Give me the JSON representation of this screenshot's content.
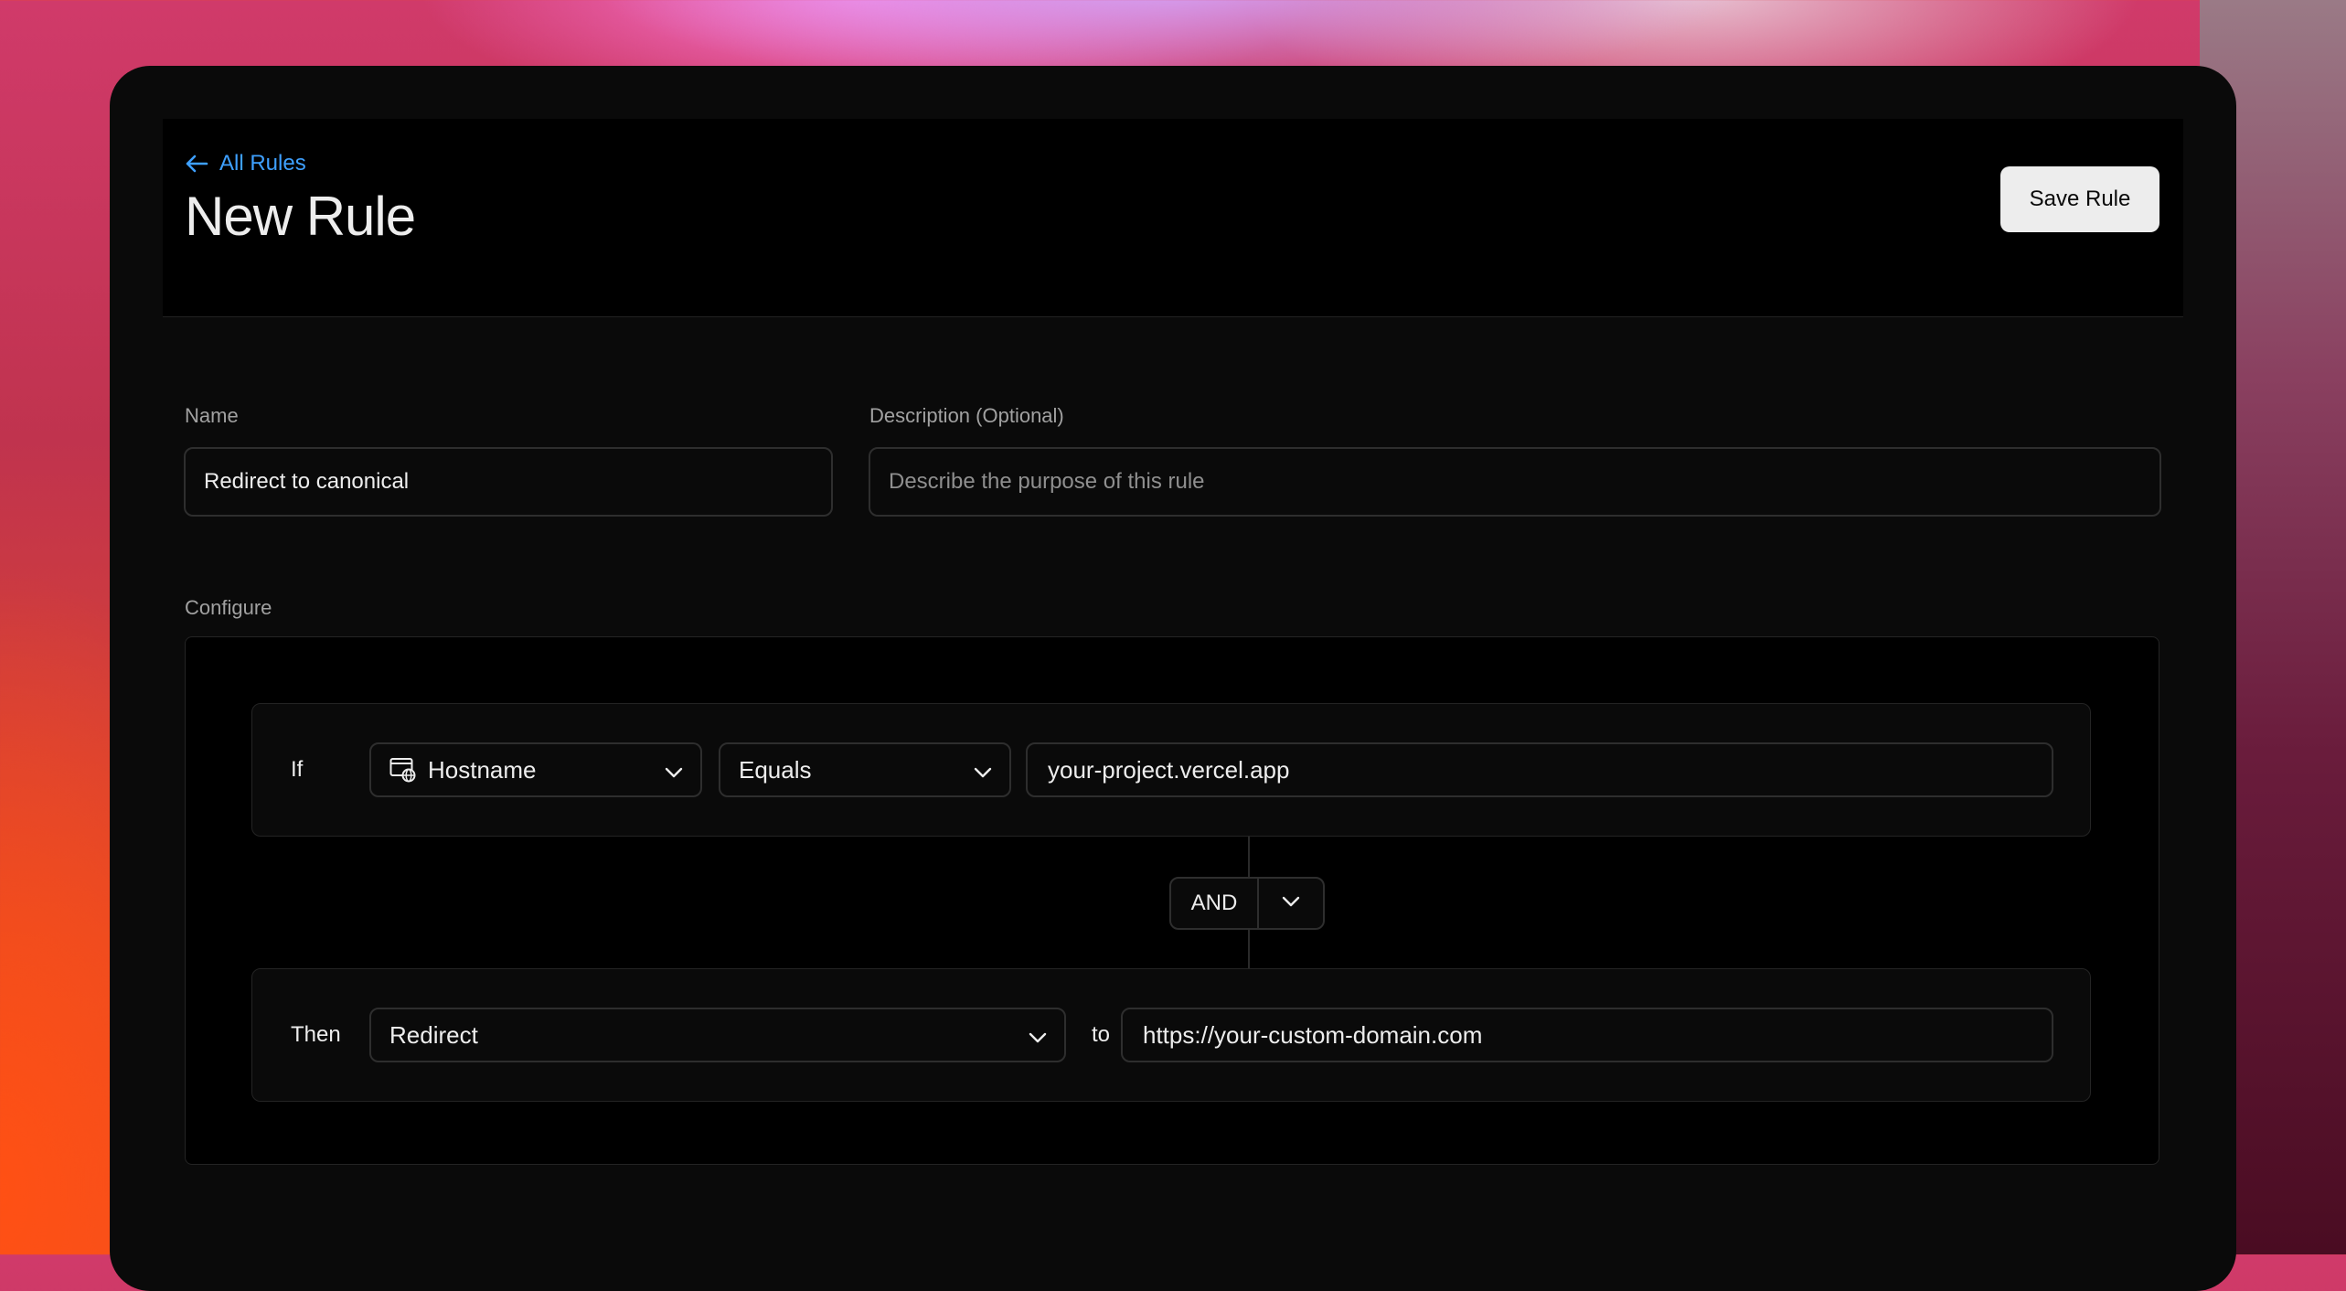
{
  "header": {
    "back_link": "All Rules",
    "title": "New Rule",
    "save_label": "Save Rule"
  },
  "form": {
    "name_label": "Name",
    "name_value": "Redirect to canonical",
    "description_label": "Description (Optional)",
    "description_placeholder": "Describe the purpose of this rule",
    "configure_label": "Configure"
  },
  "condition": {
    "if_label": "If",
    "field": "Hostname",
    "field_icon": "hostname-icon",
    "operator": "Equals",
    "value": "your-project.vercel.app"
  },
  "combinator": {
    "label": "AND"
  },
  "action": {
    "then_label": "Then",
    "type": "Redirect",
    "to_label": "to",
    "target": "https://your-custom-domain.com"
  },
  "colors": {
    "link": "#3ea0ff",
    "window_bg": "#0a0a0a",
    "header_bg": "#000000",
    "button_bg": "#ededed",
    "border": "#2e2e2e"
  }
}
